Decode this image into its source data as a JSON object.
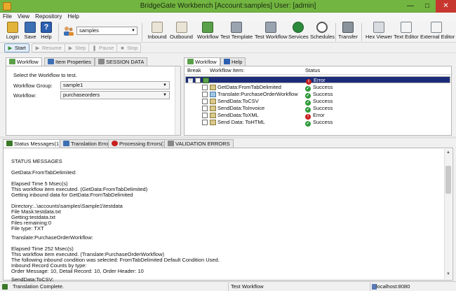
{
  "window": {
    "title": "BridgeGate Workbench [Account:samples] User: [admin]",
    "min_glyph": "—",
    "max_glyph": "□",
    "close_glyph": "✕"
  },
  "menu": [
    "File",
    "View",
    "Repository",
    "Help"
  ],
  "toolbar": {
    "login": "Login",
    "save": "Save",
    "help": "Help",
    "account_value": "samples",
    "inbound": "Inbound",
    "outbound": "Outbound",
    "workflow": "Workflow",
    "test_template": "Test Template",
    "test_workflow": "Test Workflow",
    "services": "Services",
    "schedules": "Schedules",
    "transfer": "Transfer",
    "hex_viewer": "Hex Viewer",
    "text_editor": "Text Editor",
    "external_editor": "External Editor"
  },
  "runbar": {
    "start": "Start",
    "resume": "Resume",
    "step": "Step",
    "pause": "Pause",
    "stop": "Stop"
  },
  "left_panel": {
    "tabs": [
      "Workflow",
      "Item Properties",
      "SESSION DATA"
    ],
    "instruction": "Select the Workflow to test.",
    "group_label": "Workflow Group:",
    "group_value": "sample1",
    "workflow_label": "Workflow:",
    "workflow_value": "purchaseorders"
  },
  "right_panel": {
    "tabs": [
      "Workflow",
      "Help"
    ],
    "columns": {
      "break": "Break",
      "item": "Workflow Item:",
      "status": "Status"
    },
    "root_status": "Error",
    "items": [
      {
        "name": "GetData:FromTabDelimited",
        "status": "Success",
        "ok": true
      },
      {
        "name": "Translate:PurchaseOrderWorkflow",
        "status": "Success",
        "ok": true
      },
      {
        "name": "SendData:ToCSV",
        "status": "Success",
        "ok": true
      },
      {
        "name": "SendData:ToInvoice",
        "status": "Success",
        "ok": true
      },
      {
        "name": "SendData:ToXML",
        "status": "Error",
        "ok": false
      },
      {
        "name": "Send Data: ToHTML",
        "status": "Success",
        "ok": true
      }
    ]
  },
  "bottom_tabs": [
    "Status Messages(1)",
    "Translation Errors",
    "Processing Errors(1)",
    "VALIDATION ERRORS"
  ],
  "messages": [
    "STATUS MESSAGES",
    "",
    "GetData:FromTabDelimited:",
    "",
    "Elapsed Time 5 Msec(s)",
    "This workflow item executed. (GetData:FromTabDelimited)",
    "Getting inbound data for GetData:FromTabDelimited",
    "",
    "Directory:..\\accounts\\samples\\Sample1\\testdata",
    "File Mask:testdata.txt",
    "Getting:testdata.txt",
    "Files remaining:0",
    "File type: TXT",
    "",
    "Translate:PurchaseOrderWorkflow:",
    "",
    "Elapsed Time 252 Msec(s)",
    "This workflow item executed. (Translate:PurchaseOrderWorkflow)",
    "The following inbound condition was selected: FromTabDelimited Default Condition Used.",
    "Inbound Record Counts by type:",
    "Order Message: 10, Detail Record: 10, Order Header: 10",
    "",
    "SendData:ToCSV:"
  ],
  "statusbar": {
    "message": "Translation Complete.",
    "workflow": "Test Workflow",
    "host": "localhost:8080"
  }
}
